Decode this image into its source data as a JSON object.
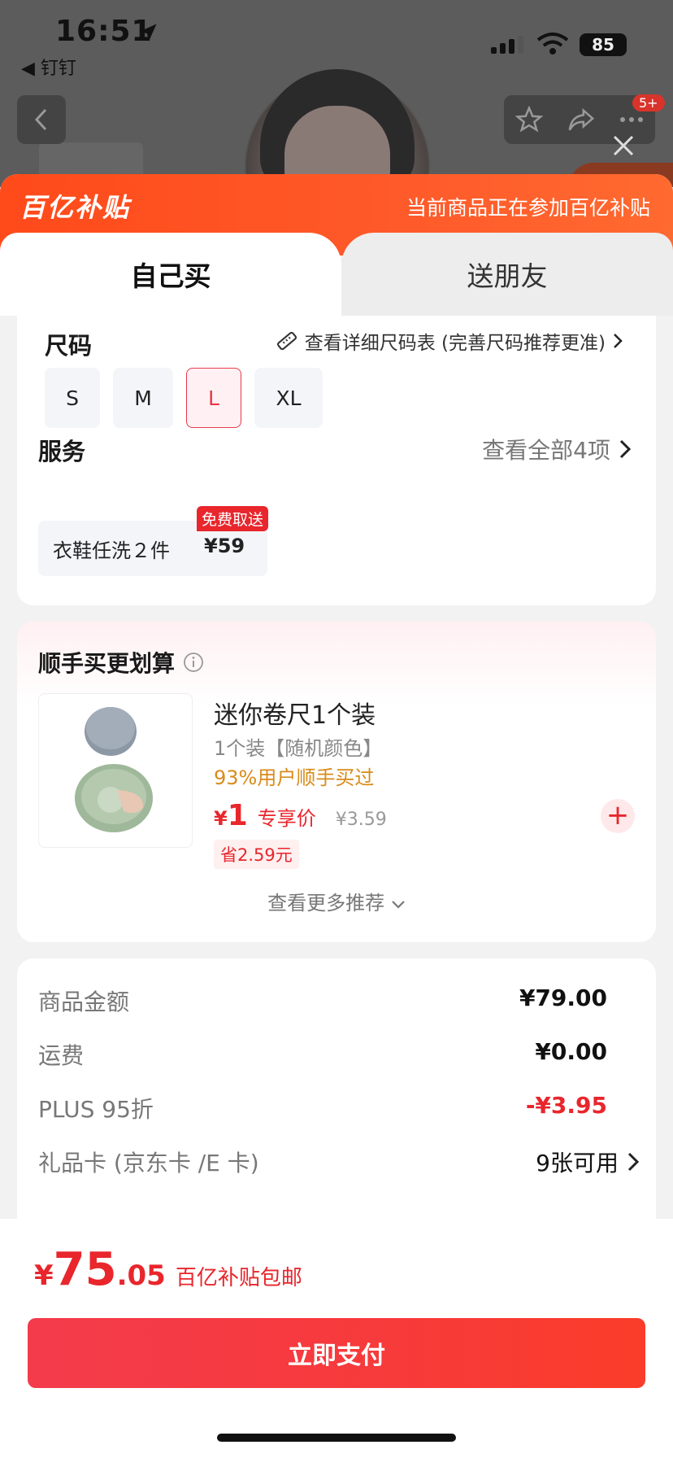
{
  "status_bar": {
    "time": "16:51",
    "back_app": "◀ 钉钉",
    "battery": "85"
  },
  "nav": {
    "badge": "5+"
  },
  "banner": {
    "logo": "百亿补贴",
    "note": "当前商品正在参加百亿补贴"
  },
  "tabs": [
    {
      "label": "自己买"
    },
    {
      "label": "送朋友"
    }
  ],
  "size": {
    "title": "尺码",
    "chart_link": "查看详细尺码表 (完善尺码推荐更准)",
    "options": [
      "S",
      "M",
      "L",
      "XL"
    ],
    "selected": "L"
  },
  "service": {
    "title": "服务",
    "view_all": "查看全部4项",
    "item_name": "衣鞋任洗２件",
    "item_price": "¥59",
    "badge": "免费取送"
  },
  "recommend": {
    "title": "顺手买更划算",
    "product_name": "迷你卷尺1个装",
    "spec": "1个装【随机颜色】",
    "stat": "93%用户顺手买过",
    "price_symbol": "¥",
    "price": "1",
    "exclusive": "专享价",
    "original": "¥3.59",
    "save": "省2.59元",
    "more": "查看更多推荐"
  },
  "summary": {
    "rows": [
      {
        "label": "商品金额",
        "value": "¥79.00"
      },
      {
        "label": "运费",
        "value": "¥0.00"
      },
      {
        "label": "PLUS 95折",
        "value": "-¥3.95"
      },
      {
        "label": "礼品卡 (京东卡 /E 卡)",
        "value": "9张可用"
      }
    ]
  },
  "footer": {
    "currency": "¥",
    "total_int": "75",
    "total_dec": ".05",
    "tag": "百亿补贴包邮",
    "pay_label": "立即支付"
  },
  "colors": {
    "accent": "#e8262c",
    "banner": "#ff4a1a",
    "stat": "#d98b1a"
  }
}
